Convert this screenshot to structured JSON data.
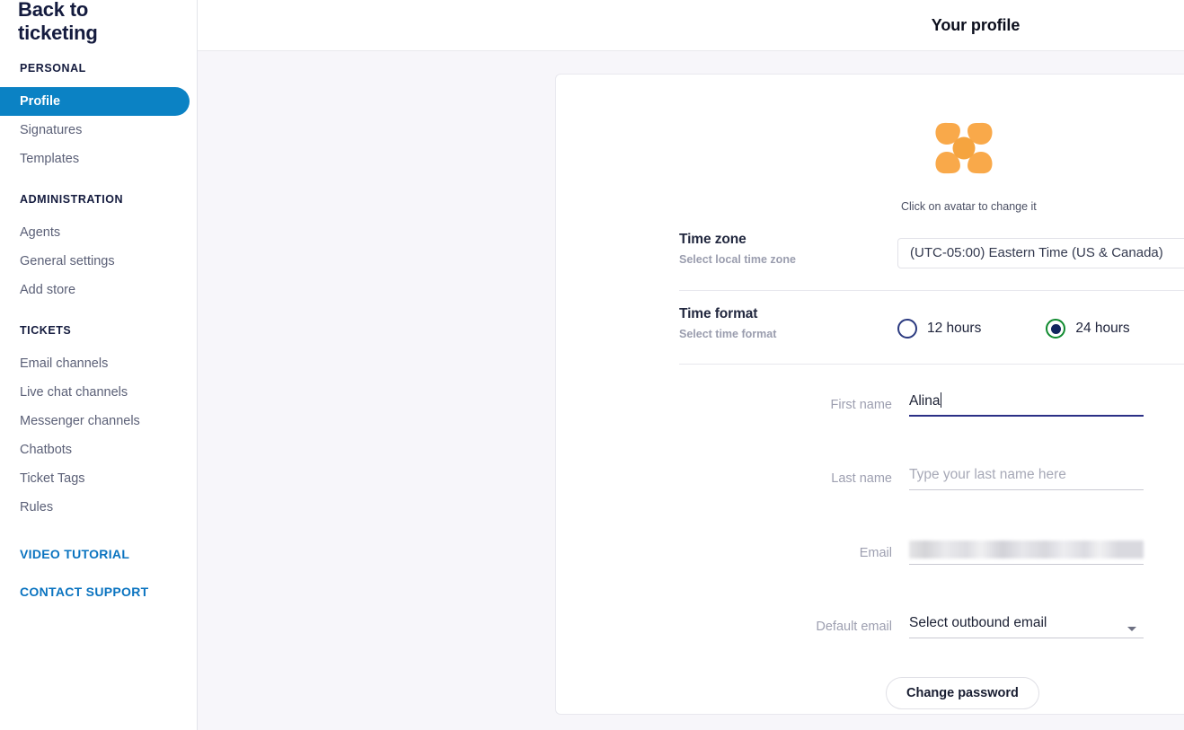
{
  "sidebar": {
    "back_label": "Back to ticketing",
    "sections": [
      {
        "heading": "PERSONAL",
        "items": [
          {
            "label": "Profile",
            "active": true
          },
          {
            "label": "Signatures",
            "active": false
          },
          {
            "label": "Templates",
            "active": false
          }
        ]
      },
      {
        "heading": "ADMINISTRATION",
        "items": [
          {
            "label": "Agents",
            "active": false
          },
          {
            "label": "General settings",
            "active": false
          },
          {
            "label": "Add store",
            "active": false
          }
        ]
      },
      {
        "heading": "TICKETS",
        "items": [
          {
            "label": "Email channels",
            "active": false
          },
          {
            "label": "Live chat channels",
            "active": false
          },
          {
            "label": "Messenger channels",
            "active": false
          },
          {
            "label": "Chatbots",
            "active": false
          },
          {
            "label": "Ticket Tags",
            "active": false
          },
          {
            "label": "Rules",
            "active": false
          }
        ]
      }
    ],
    "links": [
      {
        "label": "VIDEO TUTORIAL"
      },
      {
        "label": "CONTACT SUPPORT"
      }
    ]
  },
  "header": {
    "title": "Your profile"
  },
  "profile": {
    "avatar_hint": "Click on avatar to change it",
    "avatar_petal_color": "#f9a94a",
    "avatar_center_color": "#f5a43f",
    "settings": [
      {
        "title": "Time zone",
        "subtitle": "Select local time zone"
      },
      {
        "title": "Time format",
        "subtitle": "Select time format"
      }
    ],
    "timezone": {
      "value": "(UTC-05:00) Eastern Time (US & Canada)"
    },
    "time_format": {
      "options": [
        {
          "label": "12 hours",
          "selected": false
        },
        {
          "label": "24 hours",
          "selected": true
        }
      ],
      "selected_ring_color": "#0f8a2e",
      "unselected_ring_color": "#2b3a80"
    },
    "fields": [
      {
        "label": "First name",
        "value": "Alina",
        "placeholder": "",
        "focused": true,
        "redacted": false
      },
      {
        "label": "Last name",
        "value": "",
        "placeholder": "Type your last name here",
        "focused": false,
        "redacted": false
      },
      {
        "label": "Email",
        "value": "",
        "placeholder": "",
        "focused": false,
        "redacted": true
      },
      {
        "label": "Default email",
        "value": "Select outbound email",
        "placeholder": "",
        "focused": false,
        "redacted": false
      }
    ],
    "change_password_label": "Change password"
  },
  "colors": {
    "accent_blue": "#0b82c4",
    "link_blue": "#0b74c0",
    "navy": "#141b3e",
    "page_bg": "#f7f6fa"
  }
}
